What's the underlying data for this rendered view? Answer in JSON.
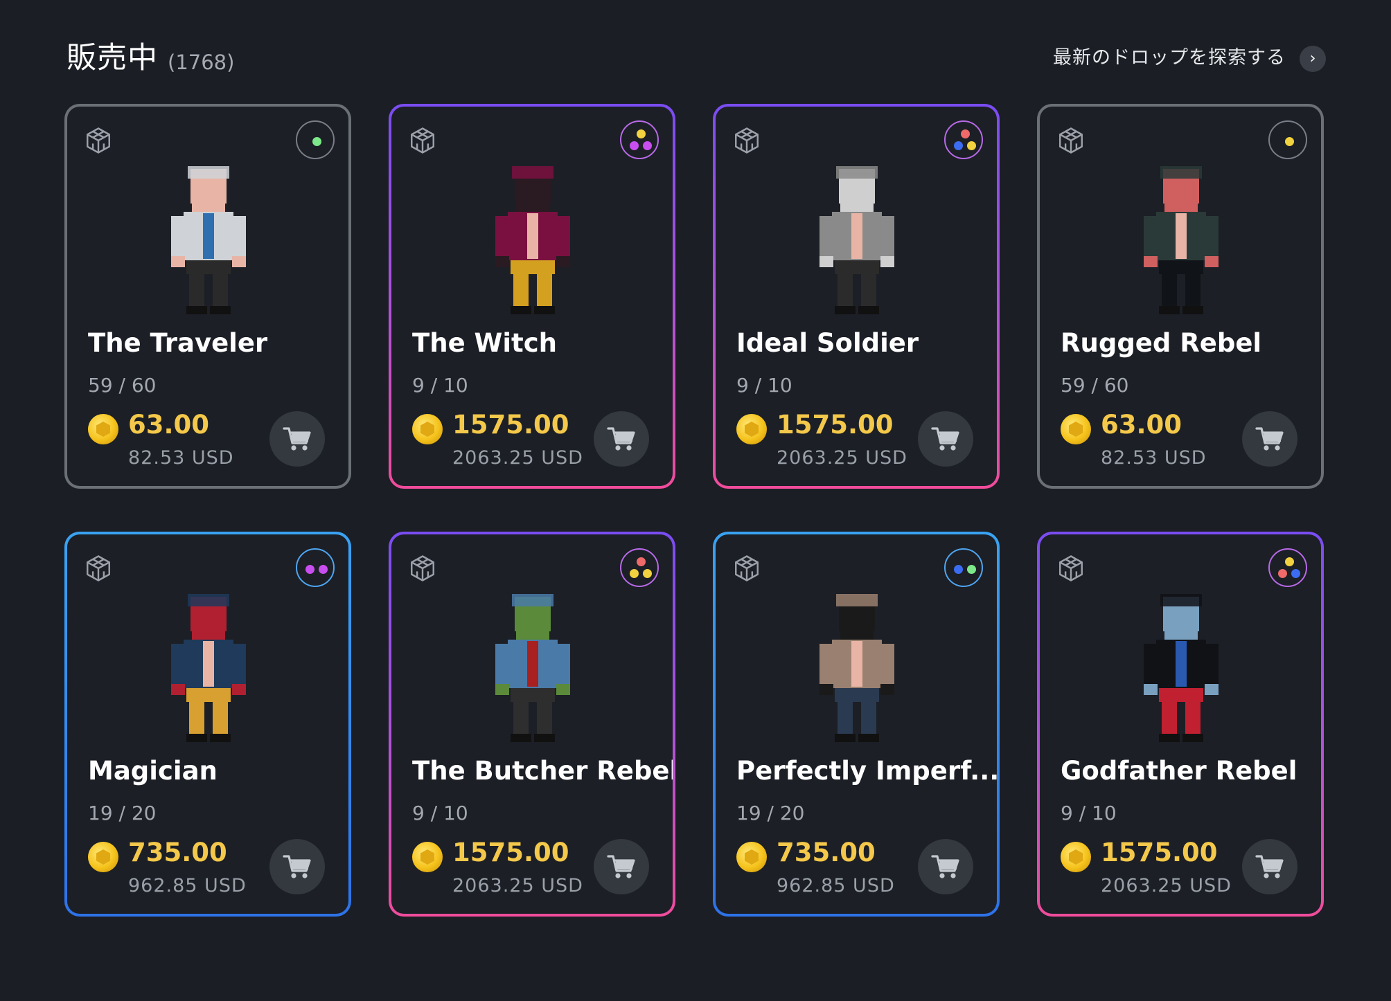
{
  "header": {
    "title": "販売中",
    "count": "(1768)",
    "link_label": "最新のドロップを探索する",
    "arrow": "›"
  },
  "colors": {
    "background": "#1b1e24",
    "card": "#1c1f26",
    "price": "#f4c84a",
    "common_border": "#6b6f76",
    "epic_border": [
      "#7a4df2",
      "#f04c9b"
    ],
    "rare_border": [
      "#3aa2f2",
      "#2e72e8"
    ]
  },
  "cards": [
    {
      "name": "The Traveler",
      "edition": "59 / 60",
      "price": "63.00",
      "usd": "82.53 USD",
      "tier": "common",
      "dots": [
        "#7de88a"
      ]
    },
    {
      "name": "The Witch",
      "edition": "9 / 10",
      "price": "1575.00",
      "usd": "2063.25 USD",
      "tier": "epic",
      "dots": [
        "#f2d23e",
        "#c94ef0",
        "#c94ef0"
      ]
    },
    {
      "name": "Ideal Soldier",
      "edition": "9 / 10",
      "price": "1575.00",
      "usd": "2063.25 USD",
      "tier": "epic",
      "dots": [
        "#f06a6a",
        "#3b6cf2",
        "#f2d23e"
      ]
    },
    {
      "name": "Rugged Rebel",
      "edition": "59 / 60",
      "price": "63.00",
      "usd": "82.53 USD",
      "tier": "common",
      "dots": [
        "#f2d23e"
      ]
    },
    {
      "name": "Magician",
      "edition": "19 / 20",
      "price": "735.00",
      "usd": "962.85 USD",
      "tier": "rare",
      "dots": [
        "#c94ef0",
        "#c94ef0"
      ]
    },
    {
      "name": "The Butcher Rebel",
      "edition": "9 / 10",
      "price": "1575.00",
      "usd": "2063.25 USD",
      "tier": "epic",
      "dots": [
        "#f06a6a",
        "#f2d23e",
        "#f2d23e"
      ]
    },
    {
      "name": "Perfectly Imperf...",
      "edition": "19 / 20",
      "price": "735.00",
      "usd": "962.85 USD",
      "tier": "rare",
      "dots": [
        "#3b6cf2",
        "#7de88a"
      ]
    },
    {
      "name": "Godfather Rebel",
      "edition": "9 / 10",
      "price": "1575.00",
      "usd": "2063.25 USD",
      "tier": "epic",
      "dots": [
        "#f2d23e",
        "#f06a6a",
        "#3b6cf2"
      ]
    }
  ],
  "icons": {
    "cube": "cube-3d-icon",
    "cart": "shopping-cart-icon",
    "coin": "sand-coin-icon",
    "rarity": "rarity-badge-icon"
  }
}
